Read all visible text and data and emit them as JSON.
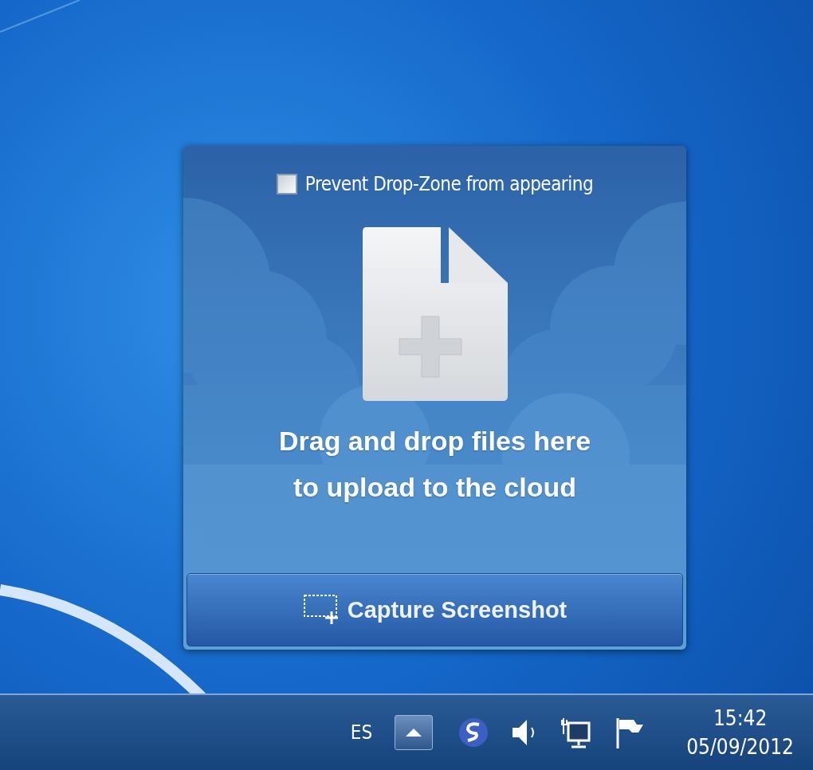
{
  "drop_zone": {
    "prevent_checkbox": {
      "label": "Prevent Drop-Zone from appearing",
      "checked": false
    },
    "message": [
      "Drag and drop files here",
      "to upload to the cloud"
    ],
    "capture_button": {
      "label": "Capture Screenshot"
    }
  },
  "taskbar": {
    "language": "ES",
    "time": "15:42",
    "date": "05/09/2012"
  }
}
